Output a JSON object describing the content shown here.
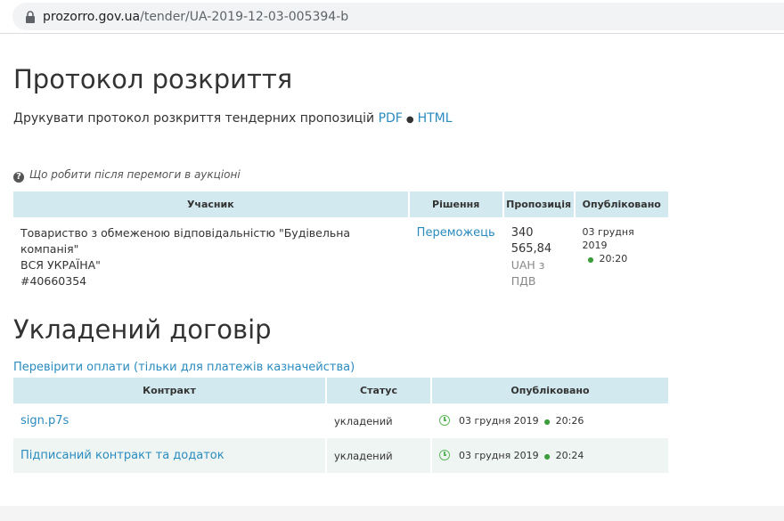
{
  "browser": {
    "url_host": "prozorro.gov.ua",
    "url_path": "/tender/UA-2019-12-03-005394-b"
  },
  "opening": {
    "title": "Протокол розкриття",
    "print_text": "Друкувати протокол розкриття тендерних пропозицій",
    "pdf_link": "PDF",
    "separator": "●",
    "html_link": "HTML",
    "help_link": "Що робити після перемоги в аукціоні",
    "table": {
      "headers": [
        "Учасник",
        "Рішення",
        "Пропозиція",
        "Опубліковано"
      ],
      "row": {
        "participant_line1": "Товариство з обмеженою відповідальністю \"Будівельна компанія\"",
        "participant_line2": "ВСЯ УКРАЇНА\"",
        "participant_code": "#40660354",
        "decision": "Переможець",
        "amount": "340 565,84",
        "currency_line1": "UAH з",
        "currency_line2": "ПДВ",
        "pub_date": "03 грудня 2019",
        "pub_time": "20:20"
      }
    }
  },
  "contract": {
    "title": "Укладений договір",
    "check_link": "Перевірити оплати (тільки для платежів казначейства)",
    "table": {
      "headers": [
        "Контракт",
        "Статус",
        "Опубліковано"
      ],
      "rows": [
        {
          "name": "sign.p7s",
          "status": "укладений",
          "date": "03 грудня 2019",
          "time": "20:26"
        },
        {
          "name": "Підписаний контракт та додаток",
          "status": "укладений",
          "date": "03 грудня 2019",
          "time": "20:24"
        }
      ]
    }
  },
  "colors": {
    "link": "#2a8bbf",
    "header_bg": "#d2e9ef",
    "accent_green": "#5cb85c"
  }
}
